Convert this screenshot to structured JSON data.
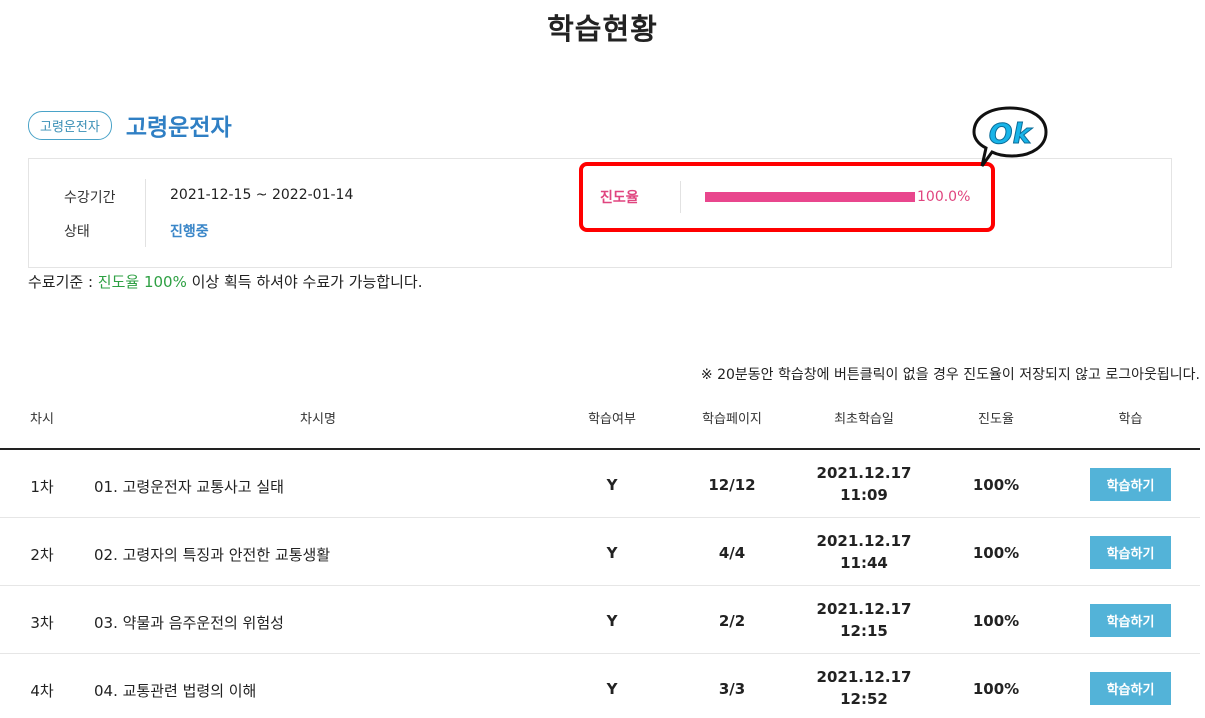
{
  "page": {
    "title": "학습현황"
  },
  "course": {
    "badge": "고령운전자",
    "name": "고령운전자"
  },
  "info": {
    "period_label": "수강기간",
    "period_value": "2021-12-15 ~ 2022-01-14",
    "status_label": "상태",
    "status_value": "진행중"
  },
  "progress": {
    "label": "진도율",
    "value_text": "100.0%",
    "percent": 100
  },
  "ok_sticker": {
    "text": "Ok"
  },
  "completion": {
    "prefix": "수료기준 : ",
    "highlight": "진도율 100%",
    "suffix": " 이상 획득 하셔야 수료가 가능합니다."
  },
  "warning": "※ 20분동안 학습창에 버튼클릭이 없을 경우 진도율이 저장되지 않고 로그아웃됩니다.",
  "table": {
    "headers": [
      "차시",
      "차시명",
      "학습여부",
      "학습페이지",
      "최초학습일",
      "진도율",
      "학습"
    ],
    "rows": [
      {
        "no": "1차",
        "title": "01. 고령운전자 교통사고 실태",
        "done": "Y",
        "page": "12/12",
        "date": "2021.12.17",
        "time": "11:09",
        "rate": "100%",
        "button": "학습하기"
      },
      {
        "no": "2차",
        "title": "02. 고령자의 특징과 안전한 교통생활",
        "done": "Y",
        "page": "4/4",
        "date": "2021.12.17",
        "time": "11:44",
        "rate": "100%",
        "button": "학습하기"
      },
      {
        "no": "3차",
        "title": "03. 약물과 음주운전의 위험성",
        "done": "Y",
        "page": "2/2",
        "date": "2021.12.17",
        "time": "12:15",
        "rate": "100%",
        "button": "학습하기"
      },
      {
        "no": "4차",
        "title": "04. 교통관련 법령의 이해",
        "done": "Y",
        "page": "3/3",
        "date": "2021.12.17",
        "time": "12:52",
        "rate": "100%",
        "button": "학습하기"
      }
    ]
  }
}
